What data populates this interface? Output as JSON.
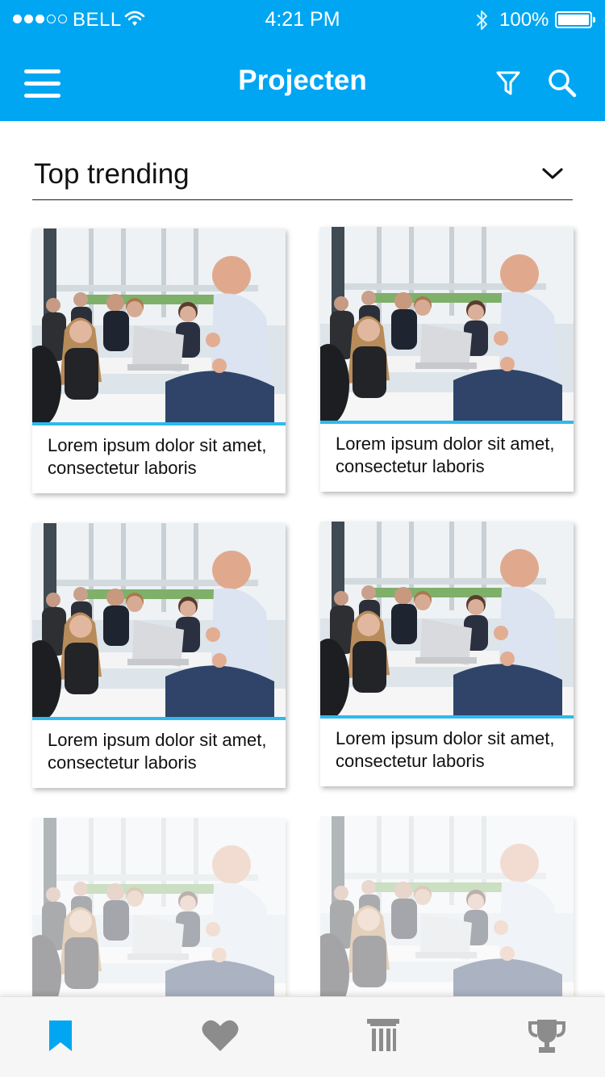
{
  "status_bar": {
    "signal_dots": [
      true,
      true,
      true,
      false,
      false
    ],
    "carrier": "BELL",
    "time": "4:21 PM",
    "battery_percent": "100%",
    "icons": [
      "wifi-icon",
      "bluetooth-icon",
      "battery-icon"
    ]
  },
  "nav": {
    "title": "Projecten",
    "left_icon": "menu-icon",
    "right_icons": [
      "filter-icon",
      "search-icon"
    ]
  },
  "dropdown": {
    "selected": "Top trending",
    "icon": "chevron-down-icon"
  },
  "cards": [
    {
      "title": "Lorem ipsum dolor sit amet, consectetur laboris",
      "image": "classroom-photo"
    },
    {
      "title": "Lorem ipsum dolor sit amet, consectetur laboris",
      "image": "classroom-photo"
    },
    {
      "title": "Lorem ipsum dolor sit amet, consectetur laboris",
      "image": "classroom-photo"
    },
    {
      "title": "Lorem ipsum dolor sit amet, consectetur laboris",
      "image": "classroom-photo"
    },
    {
      "title": "",
      "image": "classroom-photo"
    },
    {
      "title": "",
      "image": "classroom-photo"
    }
  ],
  "tabbar": {
    "tabs": [
      {
        "icon": "bookmark-icon",
        "active": true
      },
      {
        "icon": "heart-icon",
        "active": false
      },
      {
        "icon": "pillar-icon",
        "active": false
      },
      {
        "icon": "trophy-icon",
        "active": false
      }
    ]
  },
  "colors": {
    "primary": "#00a6f1",
    "accent_line": "#2fb9ee",
    "tab_active": "#00a6f1",
    "tab_inactive": "#8c8c8c",
    "text": "#111111"
  }
}
